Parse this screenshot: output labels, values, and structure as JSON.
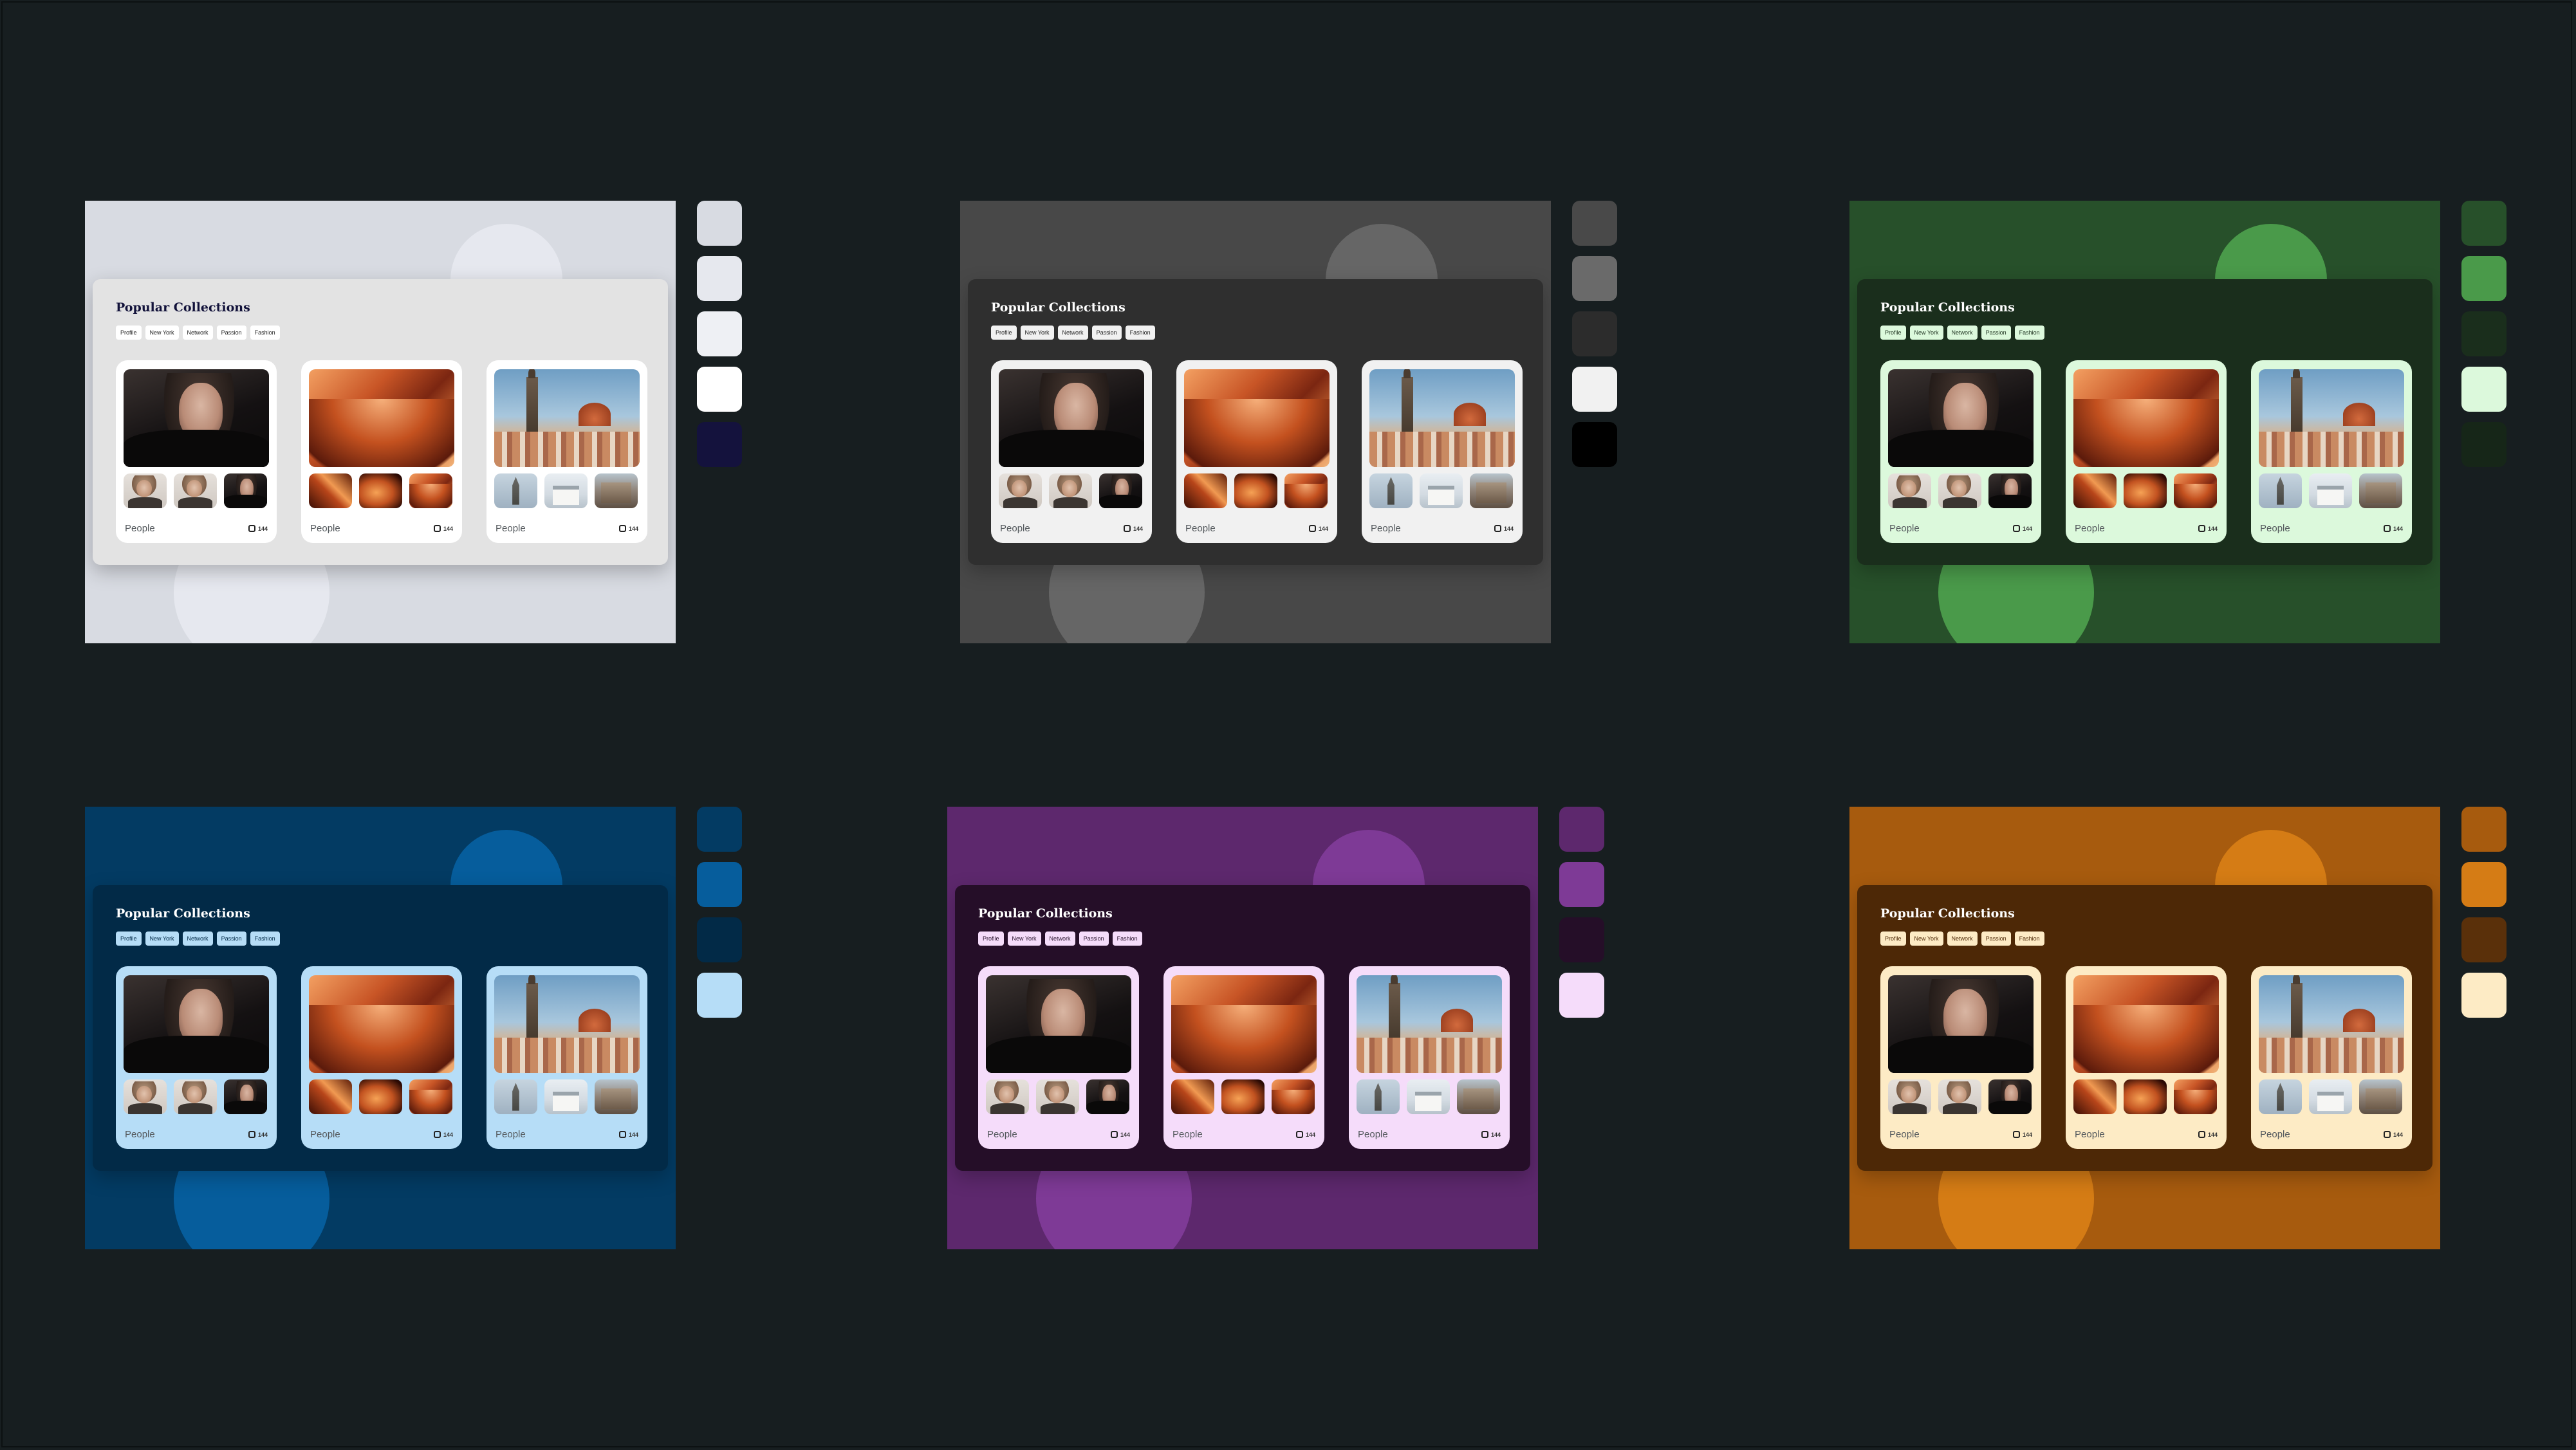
{
  "panel_title": "Popular Collections",
  "chips": [
    "Profile",
    "New York",
    "Network",
    "Passion",
    "Fashion"
  ],
  "cards": [
    {
      "label": "People",
      "count": "144",
      "hero": "portrait-photo",
      "thumbs": [
        "portrait-photo-2",
        "portrait-photo-3",
        "portrait-photo-4"
      ]
    },
    {
      "label": "People",
      "count": "144",
      "hero": "canyon-photo",
      "thumbs": [
        "canyon-photo-2",
        "canyon-photo-3",
        "canyon-photo-4"
      ]
    },
    {
      "label": "People",
      "count": "144",
      "hero": "city-photo",
      "thumbs": [
        "spire-photo",
        "white-building-photo",
        "street-photo"
      ]
    }
  ],
  "themes": [
    {
      "name": "light",
      "background": "#d8dbe2",
      "circle": "#e6e8ef",
      "panel": "#e3e3e3",
      "title_color": "#12123a",
      "chip_bg": "#ffffff",
      "chip_text": "#222222",
      "card": "#ffffff",
      "swatches": [
        "#d8dbe2",
        "#e6e8ee",
        "#eef0f4",
        "#ffffff",
        "#14123d"
      ]
    },
    {
      "name": "dark",
      "background": "#484848",
      "circle": "#666666",
      "panel": "#2f2f2f",
      "title_color": "#ffffff",
      "chip_bg": "#f1f1f1",
      "chip_text": "#222222",
      "card": "#f1f1f1",
      "swatches": [
        "#494949",
        "#6a6a6a",
        "#2c2c2c",
        "#f1f1f1",
        "#000000"
      ]
    },
    {
      "name": "green",
      "background": "#27502a",
      "circle": "#4a9a4a",
      "panel": "#1a2e1c",
      "title_color": "#ffffff",
      "chip_bg": "#dcf9dc",
      "chip_text": "#1a2e1c",
      "card": "#dcf9dc",
      "swatches": [
        "#27502a",
        "#4a9a4a",
        "#1a2e1c",
        "#dcf9dc",
        "#162618"
      ]
    },
    {
      "name": "blue",
      "background": "#033b63",
      "circle": "#065d9c",
      "panel": "#022a47",
      "title_color": "#ffffff",
      "chip_bg": "#b6ddf7",
      "chip_text": "#022a47",
      "card": "#b6ddf7",
      "swatches": [
        "#033b63",
        "#065d9c",
        "#022a47",
        "#b6ddf7"
      ]
    },
    {
      "name": "purple",
      "background": "#5d286d",
      "circle": "#7e3a96",
      "panel": "#250e28",
      "title_color": "#ffffff",
      "chip_bg": "#f5dcfa",
      "chip_text": "#250e28",
      "card": "#f5dcfa",
      "swatches": [
        "#5d286d",
        "#7e3a96",
        "#250e28",
        "#f5dcfa"
      ]
    },
    {
      "name": "orange",
      "background": "#a75b0e",
      "circle": "#d57c15",
      "panel": "#4d2806",
      "title_color": "#ffffff",
      "chip_bg": "#fdebc5",
      "chip_text": "#4d2806",
      "card": "#fdebc5",
      "swatches": [
        "#a75b0e",
        "#d57c15",
        "#5a300a",
        "#fdebc5"
      ]
    }
  ]
}
